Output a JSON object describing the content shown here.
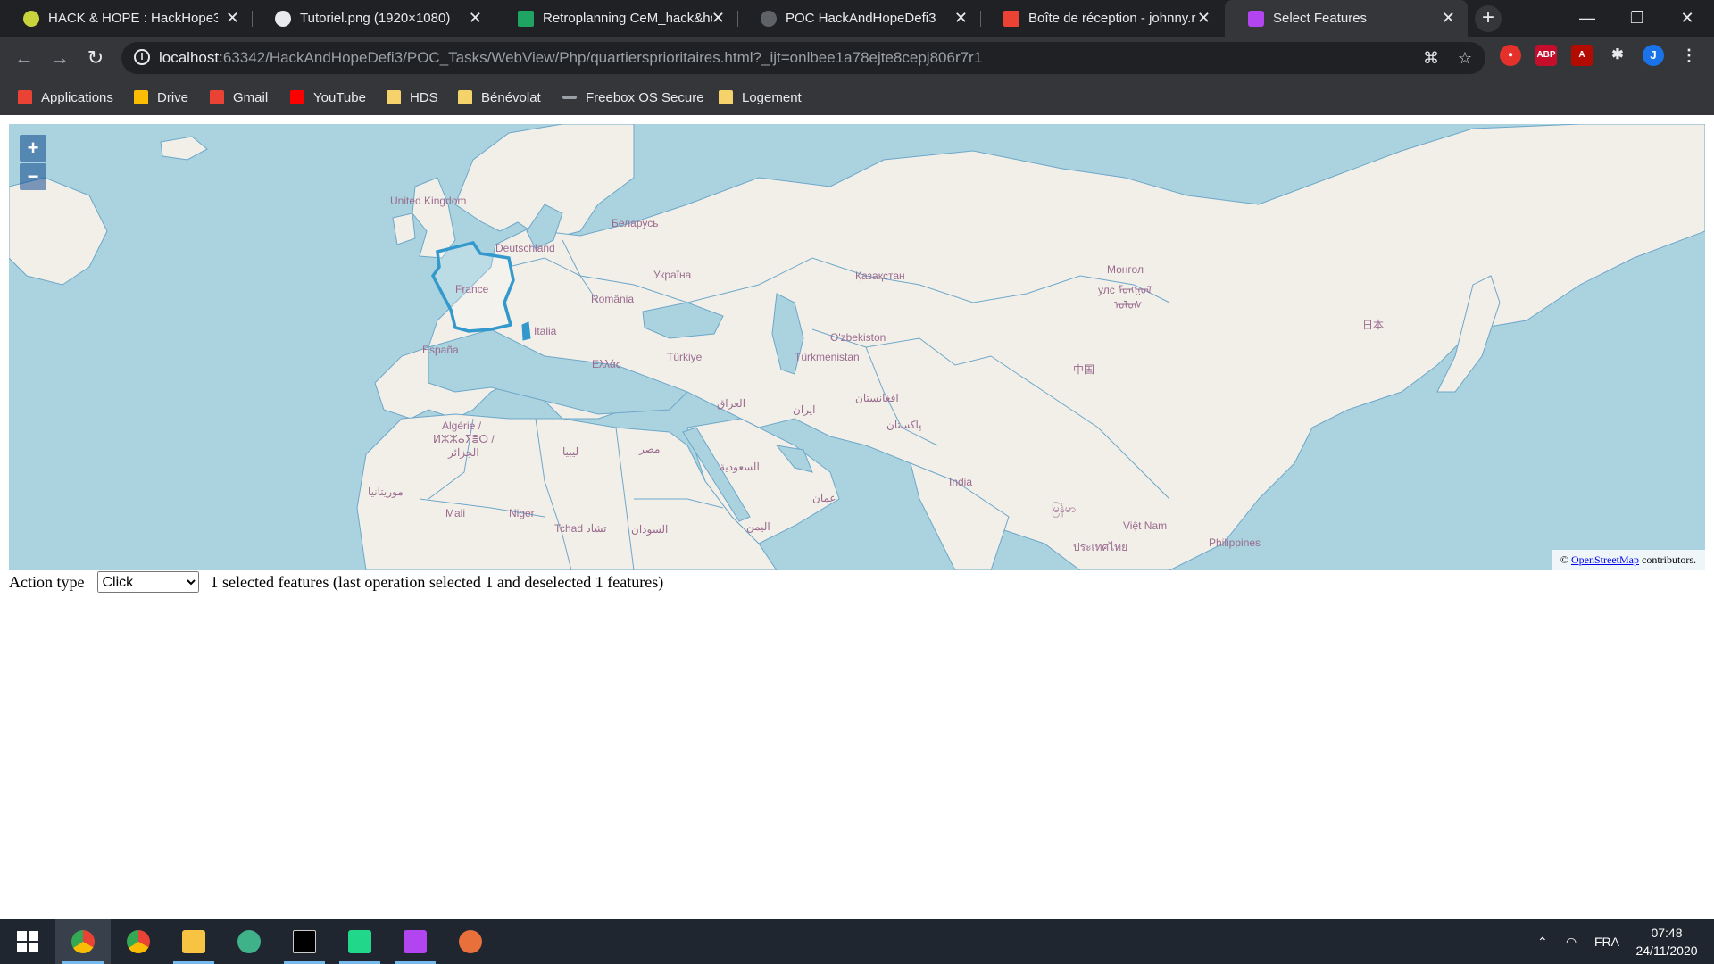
{
  "browser": {
    "tabs": [
      {
        "label": "HACK & HOPE : HackHope3",
        "icon": "hackhope-icon",
        "color": "#c9d33b"
      },
      {
        "label": "Tutoriel.png (1920×1080)",
        "icon": "globe-icon",
        "color": "#e8eaed"
      },
      {
        "label": "Retroplanning CeM_hack&hc",
        "icon": "sheets-icon",
        "color": "#1fa463"
      },
      {
        "label": "POC HackAndHopeDefi3",
        "icon": "github-icon",
        "color": "#5f6368"
      },
      {
        "label": "Boîte de réception - johnny.r",
        "icon": "gmail-icon",
        "color": "#ea4335"
      },
      {
        "label": "Select Features",
        "icon": "phpstorm-icon",
        "color": "#b345f1",
        "active": true
      }
    ],
    "new_tab": "+",
    "window_controls": {
      "minimize": "—",
      "restore": "❐",
      "close": "✕"
    },
    "url_host": "localhost",
    "url_rest": ":63342/HackAndHopeDefi3/POC_Tasks/WebView/Php/quartiersprioritaires.html?_ijt=onlbee1a78ejte8cepj806r7r1",
    "profile_initial": "J",
    "bookmarks": [
      {
        "label": "Applications",
        "icon": "apps-grid-icon",
        "color": "#ea4335"
      },
      {
        "label": "Drive",
        "icon": "drive-icon",
        "color": "#fbbc04"
      },
      {
        "label": "Gmail",
        "icon": "gmail-icon",
        "color": "#ea4335"
      },
      {
        "label": "YouTube",
        "icon": "youtube-icon",
        "color": "#ff0000"
      },
      {
        "label": "HDS",
        "icon": "folder-icon",
        "color": "#f6d26b"
      },
      {
        "label": "Bénévolat",
        "icon": "folder-icon",
        "color": "#f6d26b"
      },
      {
        "label": "Freebox OS Secure",
        "icon": "freebox-icon",
        "color": "#9aa0a6"
      },
      {
        "label": "Logement",
        "icon": "folder-icon",
        "color": "#f6d26b"
      }
    ]
  },
  "map": {
    "zoom_in": "+",
    "zoom_out": "−",
    "attribution_prefix": "©",
    "attribution_link": "OpenStreetMap",
    "attribution_suffix": "contributors.",
    "labels": [
      {
        "text": "United Kingdom"
      },
      {
        "text": "Deutschland"
      },
      {
        "text": "Беларусь"
      },
      {
        "text": "Україна"
      },
      {
        "text": "France"
      },
      {
        "text": "România"
      },
      {
        "text": "Italia"
      },
      {
        "text": "España"
      },
      {
        "text": "Ελλάς"
      },
      {
        "text": "Türkiye"
      },
      {
        "text": "Қазақстан"
      },
      {
        "text": "Монгол"
      },
      {
        "text": "улс ᠮᠤᠩᠭᠤᠯ"
      },
      {
        "text": "ᠤᠯᠤᠰ"
      },
      {
        "text": "O'zbekiston"
      },
      {
        "text": "Türkmenistan"
      },
      {
        "text": "中国"
      },
      {
        "text": "日本"
      },
      {
        "text": "Algérie /"
      },
      {
        "text": "ⵍⵣⵣⴰⵢⴻⵔ /"
      },
      {
        "text": "الجزائر"
      },
      {
        "text": "ليبيا"
      },
      {
        "text": "مصر"
      },
      {
        "text": "العراق"
      },
      {
        "text": "ایران"
      },
      {
        "text": "افغانستان"
      },
      {
        "text": "پاکستان"
      },
      {
        "text": "السعودية"
      },
      {
        "text": "India"
      },
      {
        "text": "موريتانيا"
      },
      {
        "text": "Mali"
      },
      {
        "text": "Niger"
      },
      {
        "text": "Tchad تشاد"
      },
      {
        "text": "السودان"
      },
      {
        "text": "اليمن"
      },
      {
        "text": "عمان"
      },
      {
        "text": "Việt Nam"
      },
      {
        "text": "Philippines"
      },
      {
        "text": "မြန်မာ"
      },
      {
        "text": "ประเทศไทย"
      }
    ],
    "selected_feature": "France",
    "selection_color": "#3399cc"
  },
  "controls": {
    "action_label": "Action type",
    "action_value": "Click",
    "status": "1 selected features (last operation selected 1 and deselected 1 features)"
  },
  "taskbar": {
    "apps": [
      {
        "icon": "windows-start-icon",
        "color": "#ffffff"
      },
      {
        "icon": "chrome-icon",
        "color": "#4285f4",
        "active": true
      },
      {
        "icon": "chrome-profile-icon",
        "color": "#34a853"
      },
      {
        "icon": "file-explorer-icon",
        "color": "#f6c343"
      },
      {
        "icon": "atom-icon",
        "color": "#40b28a"
      },
      {
        "icon": "terminal-icon",
        "color": "#000000"
      },
      {
        "icon": "pycharm-icon",
        "color": "#21d789"
      },
      {
        "icon": "phpstorm-icon",
        "color": "#b345f1"
      },
      {
        "icon": "app-icon",
        "color": "#e8703a"
      }
    ],
    "language": "FRA",
    "time": "07:48",
    "date": "24/11/2020"
  }
}
